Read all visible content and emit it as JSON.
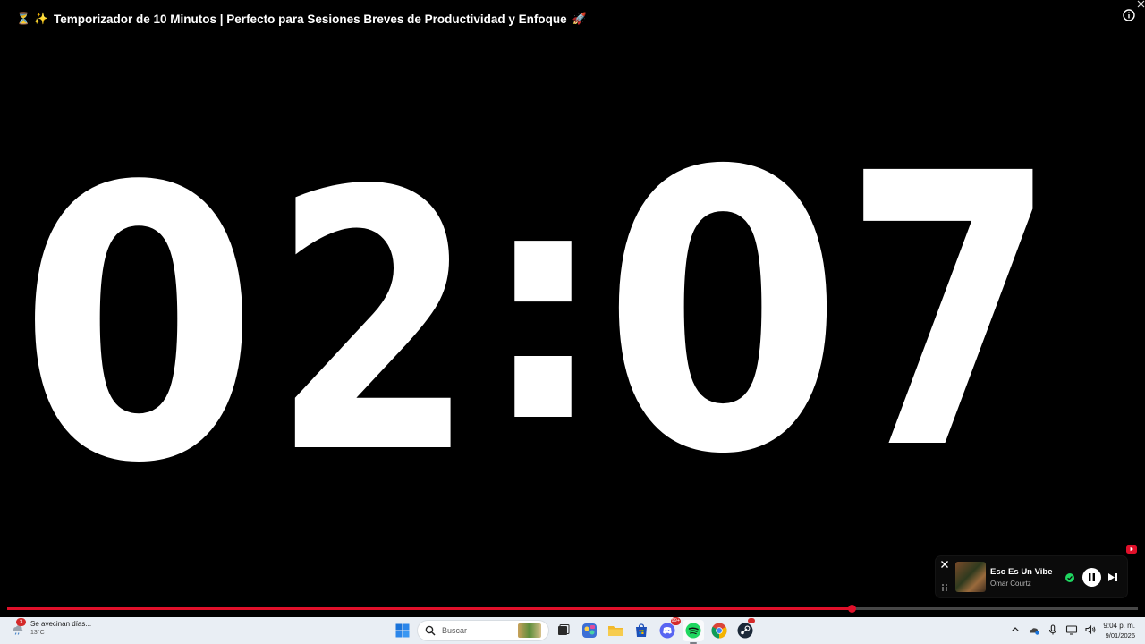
{
  "video": {
    "title_emoji_left": "⏳ ✨",
    "title": "Temporizador de 10 Minutos | Perfecto para Sesiones Breves de Productividad y Enfoque",
    "title_emoji_right": "🚀",
    "timer": {
      "d1": "0",
      "d2": "2",
      "sep": ":",
      "d3": "0",
      "d4": "7"
    },
    "progress_fraction": 0.747,
    "colors": {
      "progress": "#e0102a",
      "background": "#000000",
      "digits": "#ffffff"
    }
  },
  "mini_player": {
    "track": "Eso Es Un Vibe",
    "artist": "Omar Courtz",
    "liked_color": "#1ed760"
  },
  "taskbar": {
    "weather": {
      "title": "Se avecinan días...",
      "temp": "13°C",
      "badge": "3"
    },
    "search_label": "Buscar",
    "discord_badge": "99+",
    "time": "9:04 p. m.",
    "date": "9/01/2026",
    "icons": [
      "windows-start-icon",
      "search-icon",
      "task-view-icon",
      "copilot-icon",
      "file-explorer-icon",
      "microsoft-store-icon",
      "discord-icon",
      "spotify-icon",
      "chrome-icon",
      "steam-icon",
      "chevron-up-icon",
      "onedrive-icon",
      "microphone-icon",
      "display-icon",
      "speaker-icon"
    ]
  }
}
